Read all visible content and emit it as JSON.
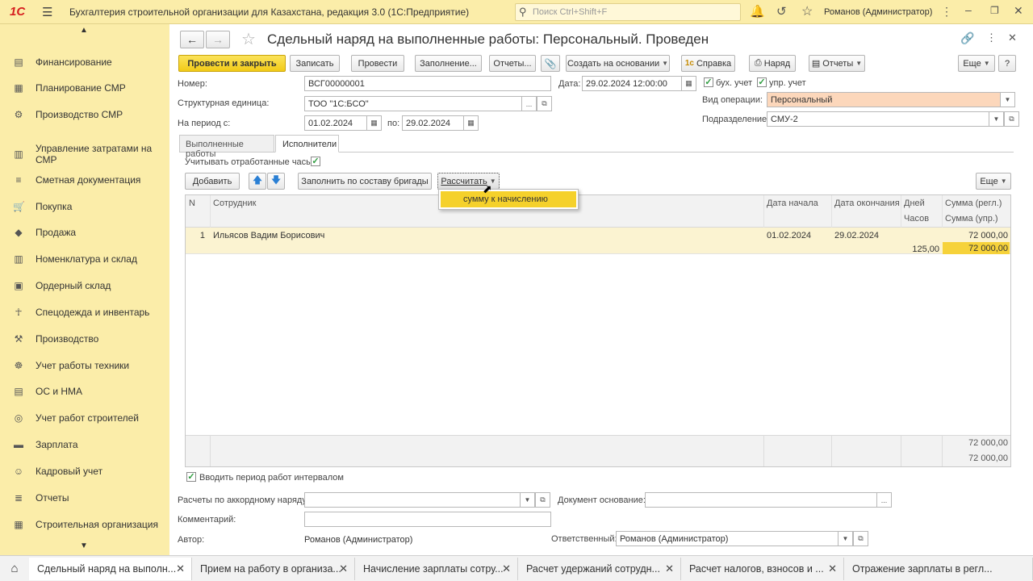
{
  "app": {
    "logo": "1С",
    "title": "Бухгалтерия строительной организации для Казахстана, редакция 3.0  (1С:Предприятие)",
    "search_placeholder": "Поиск Ctrl+Shift+F",
    "user": "Романов (Администратор)"
  },
  "sidebar": {
    "items": [
      {
        "label": "Финансирование",
        "icon": "money-icon"
      },
      {
        "label": "Планирование СМР",
        "icon": "calendar-icon"
      },
      {
        "label": "Производство СМР",
        "icon": "production-icon"
      },
      {
        "label": "Управление затратами на СМР",
        "icon": "costs-icon"
      },
      {
        "label": "Сметная документация",
        "icon": "estimate-icon"
      },
      {
        "label": "Покупка",
        "icon": "cart-icon"
      },
      {
        "label": "Продажа",
        "icon": "sales-icon"
      },
      {
        "label": "Номенклатура и склад",
        "icon": "warehouse-icon"
      },
      {
        "label": "Ордерный склад",
        "icon": "order-warehouse-icon"
      },
      {
        "label": "Спецодежда и инвентарь",
        "icon": "uniform-icon"
      },
      {
        "label": "Производство",
        "icon": "factory-icon"
      },
      {
        "label": "Учет работы техники",
        "icon": "machinery-icon"
      },
      {
        "label": "ОС и НМА",
        "icon": "assets-icon"
      },
      {
        "label": "Учет работ строителей",
        "icon": "builders-icon"
      },
      {
        "label": "Зарплата",
        "icon": "salary-icon"
      },
      {
        "label": "Кадровый учет",
        "icon": "hr-icon"
      },
      {
        "label": "Отчеты",
        "icon": "reports-icon"
      },
      {
        "label": "Строительная организация",
        "icon": "organization-icon"
      }
    ]
  },
  "doc": {
    "title": "Сдельный наряд на выполненные работы: Персональный. Проведен",
    "toolbar": {
      "post_close": "Провести и закрыть",
      "save": "Записать",
      "post": "Провести",
      "fill": "Заполнение...",
      "reports1": "Отчеты...",
      "create_based": "Создать на основании",
      "help": "Справка",
      "order": "Наряд",
      "reports2": "Отчеты",
      "more": "Еще",
      "question": "?"
    },
    "fields": {
      "number_label": "Номер:",
      "number_value": "ВСГ00000001",
      "date_label": "Дата:",
      "date_value": "29.02.2024 12:00:00",
      "buh_label": "бух. учет",
      "upr_label": "упр. учет",
      "unit_label": "Структурная единица:",
      "unit_value": "ТОО \"1С:БСО\"",
      "op_label": "Вид операции:",
      "op_value": "Персональный",
      "period_label": "На период с:",
      "period_from": "01.02.2024",
      "period_to_label": "по:",
      "period_to": "29.02.2024",
      "division_label": "Подразделение:",
      "division_value": "СМУ-2"
    },
    "tabs": [
      "Выполненные работы",
      "Исполнители"
    ],
    "hours_label": "Учитывать отработанные часы:",
    "table_toolbar": {
      "add": "Добавить",
      "fill_brigade": "Заполнить по составу бригады",
      "calculate": "Рассчитать",
      "more": "Еще"
    },
    "dropdown_item": "сумму к начислению",
    "table": {
      "headers": {
        "n": "N",
        "employee": "Сотрудник",
        "start": "Дата начала",
        "end": "Дата окончания",
        "days": "Дней",
        "hours": "Часов",
        "sum_reg": "Сумма (регл.)",
        "sum_upr": "Сумма (упр.)"
      },
      "rows": [
        {
          "n": "1",
          "employee": "Ильясов Вадим Борисович",
          "start": "01.02.2024",
          "end": "29.02.2024",
          "days": "",
          "hours": "125,00",
          "sum_reg": "72 000,00",
          "sum_upr": "72 000,00"
        }
      ],
      "total_reg": "72 000,00",
      "total_upr": "72 000,00"
    },
    "interval_label": "Вводить период работ интервалом",
    "bottom": {
      "accord_label": "Расчеты по аккордному наряду:",
      "accord_value": "",
      "basis_label": "Документ основание:",
      "basis_value": "",
      "comment_label": "Комментарий:",
      "comment_value": "",
      "author_label": "Автор:",
      "author_value": "Романов (Администратор)",
      "responsible_label": "Ответственный:",
      "responsible_value": "Романов (Администратор)"
    }
  },
  "taskbar": {
    "tabs": [
      "Сдельный наряд на выполн...",
      "Прием на работу в организа...",
      "Начисление зарплаты сотру...",
      "Расчет удержаний сотрудн...",
      "Расчет налогов, взносов и ...",
      "Отражение зарплаты в регл..."
    ]
  },
  "colors": {
    "accent_yellow": "#f2cb17",
    "panel": "#fbeda9",
    "selection": "#fcd7bb"
  }
}
